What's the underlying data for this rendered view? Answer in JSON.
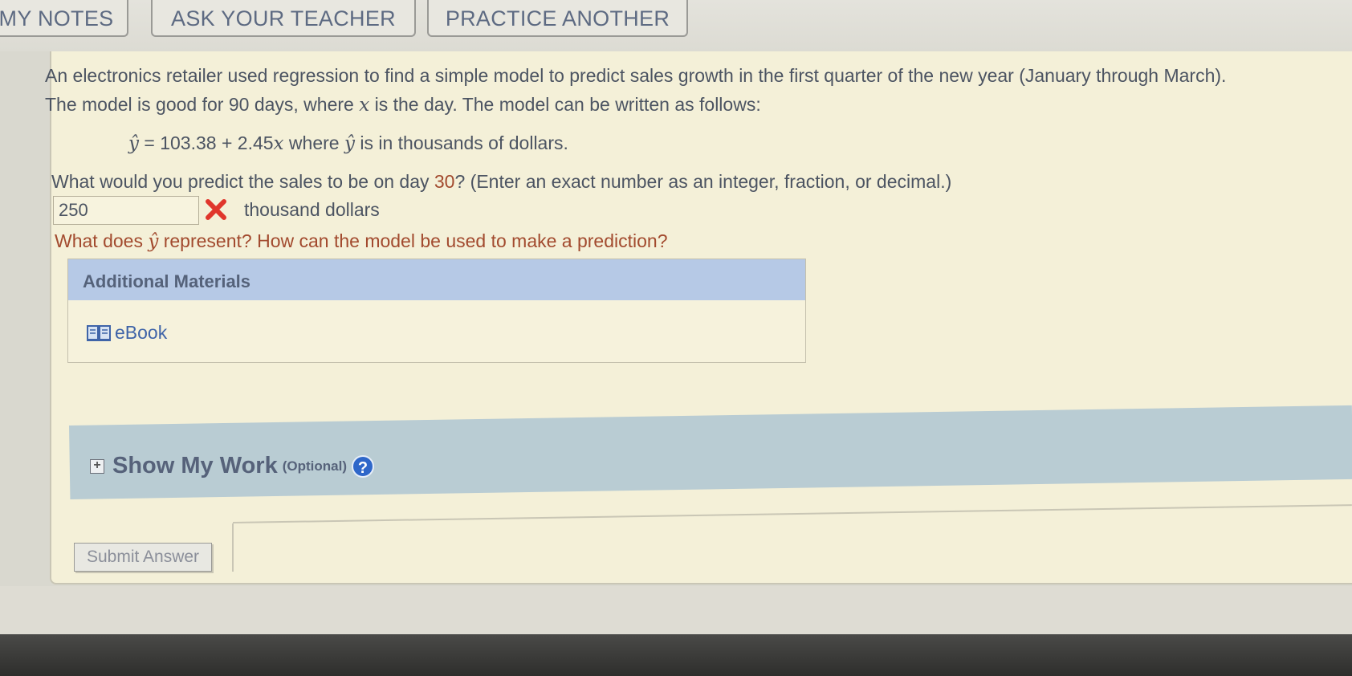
{
  "toolbar": {
    "my_notes": "MY NOTES",
    "ask_teacher": "ASK YOUR TEACHER",
    "practice_another": "PRACTICE ANOTHER"
  },
  "problem": {
    "line1": "An electronics retailer used regression to find a simple model to predict sales growth in the first quarter of the new year (January through March).",
    "line2_pre": "The model is good for 90 days, where ",
    "line2_var": "x",
    "line2_post": " is the day. The model can be written as follows:",
    "model_lhs": "ŷ",
    "model_eq": " = 103.38 + 2.45",
    "model_var": "x",
    "model_mid": "  where ",
    "model_yhat": "ŷ",
    "model_post": " is in thousands of dollars."
  },
  "question1": {
    "pre": "What would you predict the sales to be on day ",
    "day": "30",
    "post": "? (Enter an exact number as an integer, fraction, or decimal.)",
    "answer_value": "250",
    "unit": "thousand dollars",
    "status_icon": "x-mark-icon",
    "status_color": "#e0362c"
  },
  "question2": {
    "pre": "What does ",
    "yhat": "ŷ",
    "post": " represent? How can the model be used to make a prediction?"
  },
  "additional_materials": {
    "header": "Additional Materials",
    "ebook_label": "eBook",
    "ebook_icon": "book-icon"
  },
  "show_work": {
    "title": "Show My Work",
    "optional": "(Optional)",
    "help": "?"
  },
  "submit": {
    "label": "Submit Answer"
  }
}
